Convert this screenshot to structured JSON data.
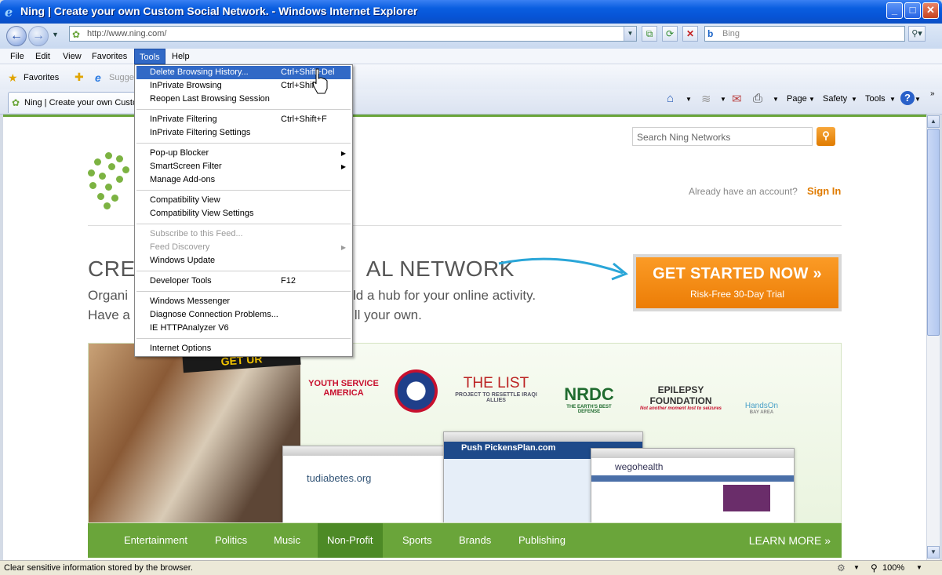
{
  "window": {
    "title": "Ning | Create your own Custom Social Network. - Windows Internet Explorer",
    "buttons": {
      "minimize": "_",
      "maximize": "□",
      "close": "✕"
    }
  },
  "address_bar": {
    "url": "http://www.ning.com/",
    "search_placeholder": "Bing"
  },
  "menu_bar": {
    "items": [
      "File",
      "Edit",
      "View",
      "Favorites",
      "Tools",
      "Help"
    ],
    "active": "Tools"
  },
  "favorites_bar": {
    "favorites_label": "Favorites",
    "suggested_label": "Sugge"
  },
  "tab": {
    "title": "Ning | Create your own Custom Social Network."
  },
  "command_bar": {
    "page": "Page",
    "safety": "Safety",
    "tools": "Tools"
  },
  "tools_menu": {
    "items": [
      {
        "label": "Delete Browsing History...",
        "shortcut": "Ctrl+Shift+Del",
        "highlighted": true
      },
      {
        "label": "InPrivate Browsing",
        "shortcut": "Ctrl+Shift+P"
      },
      {
        "label": "Reopen Last Browsing Session",
        "shortcut": ""
      },
      {
        "label": "InPrivate Filtering",
        "shortcut": "Ctrl+Shift+F"
      },
      {
        "label": "InPrivate Filtering Settings",
        "shortcut": ""
      },
      {
        "label": "Pop-up Blocker",
        "shortcut": "",
        "submenu": true
      },
      {
        "label": "SmartScreen Filter",
        "shortcut": "",
        "submenu": true
      },
      {
        "label": "Manage Add-ons",
        "shortcut": ""
      },
      {
        "label": "Compatibility View",
        "shortcut": ""
      },
      {
        "label": "Compatibility View Settings",
        "shortcut": ""
      },
      {
        "label": "Subscribe to this Feed...",
        "shortcut": "",
        "disabled": true
      },
      {
        "label": "Feed Discovery",
        "shortcut": "",
        "disabled": true,
        "submenu": true
      },
      {
        "label": "Windows Update",
        "shortcut": ""
      },
      {
        "label": "Developer Tools",
        "shortcut": "F12"
      },
      {
        "label": "Windows Messenger",
        "shortcut": ""
      },
      {
        "label": "Diagnose Connection Problems...",
        "shortcut": ""
      },
      {
        "label": "IE HTTPAnalyzer V6",
        "shortcut": ""
      },
      {
        "label": "Internet Options",
        "shortcut": ""
      }
    ]
  },
  "page": {
    "search_placeholder": "Search Ning Networks",
    "already_text": "Already have an account?",
    "sign_in": "Sign In",
    "headline_left": "CREA",
    "headline_right": "AL NETWORK",
    "subline1_left": "Organi",
    "subline1_right": "ld a hub for your online activity.",
    "subline2_left": "Have a",
    "subline2_right": "ll your own.",
    "cta_title": "GET STARTED NOW »",
    "cta_sub": "Risk-Free 30-Day Trial",
    "hero_band": "GET UR",
    "orgs": {
      "youth": "YOUTH SERVICE AMERICA",
      "list": "THE LIST",
      "list_sub": "PROJECT TO RESETTLE IRAQI ALLIES",
      "nrdc": "NRDC",
      "nrdc_sub": "THE EARTH'S BEST DEFENSE",
      "epilepsy": "EPILEPSY FOUNDATION",
      "epilepsy_sub": "Not another moment lost to seizures",
      "handson": "HandsOn",
      "handson_sub": "BAY AREA"
    },
    "shots": {
      "tudiabetes": "tudiabetes.org",
      "pushpickens": "Push PickensPlan.com",
      "wegohealth": "wegohealth"
    },
    "nav": [
      "Entertainment",
      "Politics",
      "Music",
      "Non-Profit",
      "Sports",
      "Brands",
      "Publishing"
    ],
    "learn_more": "LEARN MORE »"
  },
  "status_bar": {
    "text": "Clear sensitive information stored by the browser.",
    "zoom": "100%"
  },
  "colors": {
    "ning_green": "#6aa53a",
    "cta_orange": "#ec7d06",
    "menu_highlight": "#3169c6"
  }
}
